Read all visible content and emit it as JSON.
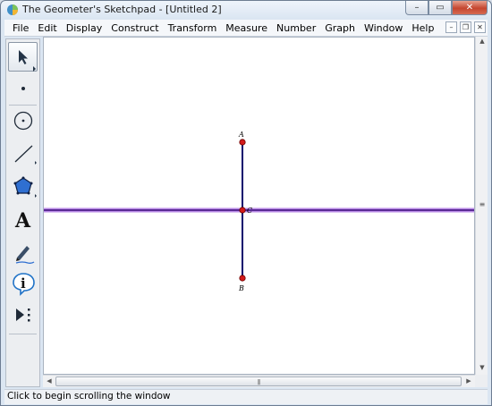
{
  "window": {
    "title": "The Geometer's Sketchpad - [Untitled 2]"
  },
  "caption": {
    "minimize": "–",
    "maximize": "▭",
    "close": "✕"
  },
  "menu": [
    "File",
    "Edit",
    "Display",
    "Construct",
    "Transform",
    "Measure",
    "Number",
    "Graph",
    "Window",
    "Help"
  ],
  "doc_controls": {
    "minimize": "–",
    "restore": "❐",
    "close": "✕"
  },
  "toolbox": {
    "tools": [
      {
        "name": "selection-arrow-tool",
        "icon": "arrow-pointer-icon",
        "active": true
      },
      {
        "name": "point-tool",
        "icon": "point-icon",
        "active": false
      },
      {
        "name": "compass-tool",
        "icon": "circle-icon",
        "active": false
      },
      {
        "name": "straightedge-tool",
        "icon": "line-segment-icon",
        "active": false
      },
      {
        "name": "polygon-tool",
        "icon": "pentagon-icon",
        "active": false
      },
      {
        "name": "text-tool",
        "icon": "letter-a-icon",
        "active": false
      },
      {
        "name": "marker-tool",
        "icon": "pen-icon",
        "active": false
      },
      {
        "name": "information-tool",
        "icon": "info-icon",
        "active": false
      },
      {
        "name": "custom-tool",
        "icon": "play-dots-icon",
        "active": false
      }
    ],
    "text_tool_glyph": "A",
    "info_tool_glyph": "i"
  },
  "sketch": {
    "points": [
      {
        "label": "A"
      },
      {
        "label": "B"
      },
      {
        "label": "C"
      }
    ],
    "colors": {
      "segment": "#0b0b6e",
      "line": "#3a0a7a",
      "line_highlight": "#b98ae6",
      "point": "#d31a1a"
    }
  },
  "scrollbars": {
    "grip": "|||"
  },
  "status": {
    "text": "Click to begin scrolling the window"
  }
}
